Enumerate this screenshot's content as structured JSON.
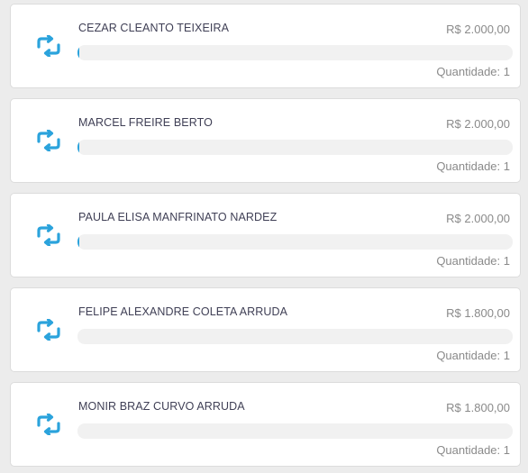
{
  "accent_color": "#2ba3dc",
  "items": [
    {
      "icon": "retweet-icon",
      "name": "CEZAR CLEANTO TEIXEIRA",
      "price": "R$ 2.000,00",
      "quantity": "Quantidade: 1",
      "progress": 0.004
    },
    {
      "icon": "retweet-icon",
      "name": "MARCEL FREIRE BERTO",
      "price": "R$ 2.000,00",
      "quantity": "Quantidade: 1",
      "progress": 0.004
    },
    {
      "icon": "retweet-icon",
      "name": "PAULA ELISA MANFRINATO NARDEZ",
      "price": "R$ 2.000,00",
      "quantity": "Quantidade: 1",
      "progress": 0.004
    },
    {
      "icon": "retweet-icon",
      "name": "FELIPE ALEXANDRE COLETA ARRUDA",
      "price": "R$ 1.800,00",
      "quantity": "Quantidade: 1",
      "progress": 0
    },
    {
      "icon": "retweet-icon",
      "name": "MONIR BRAZ CURVO ARRUDA",
      "price": "R$ 1.800,00",
      "quantity": "Quantidade: 1",
      "progress": 0
    }
  ]
}
